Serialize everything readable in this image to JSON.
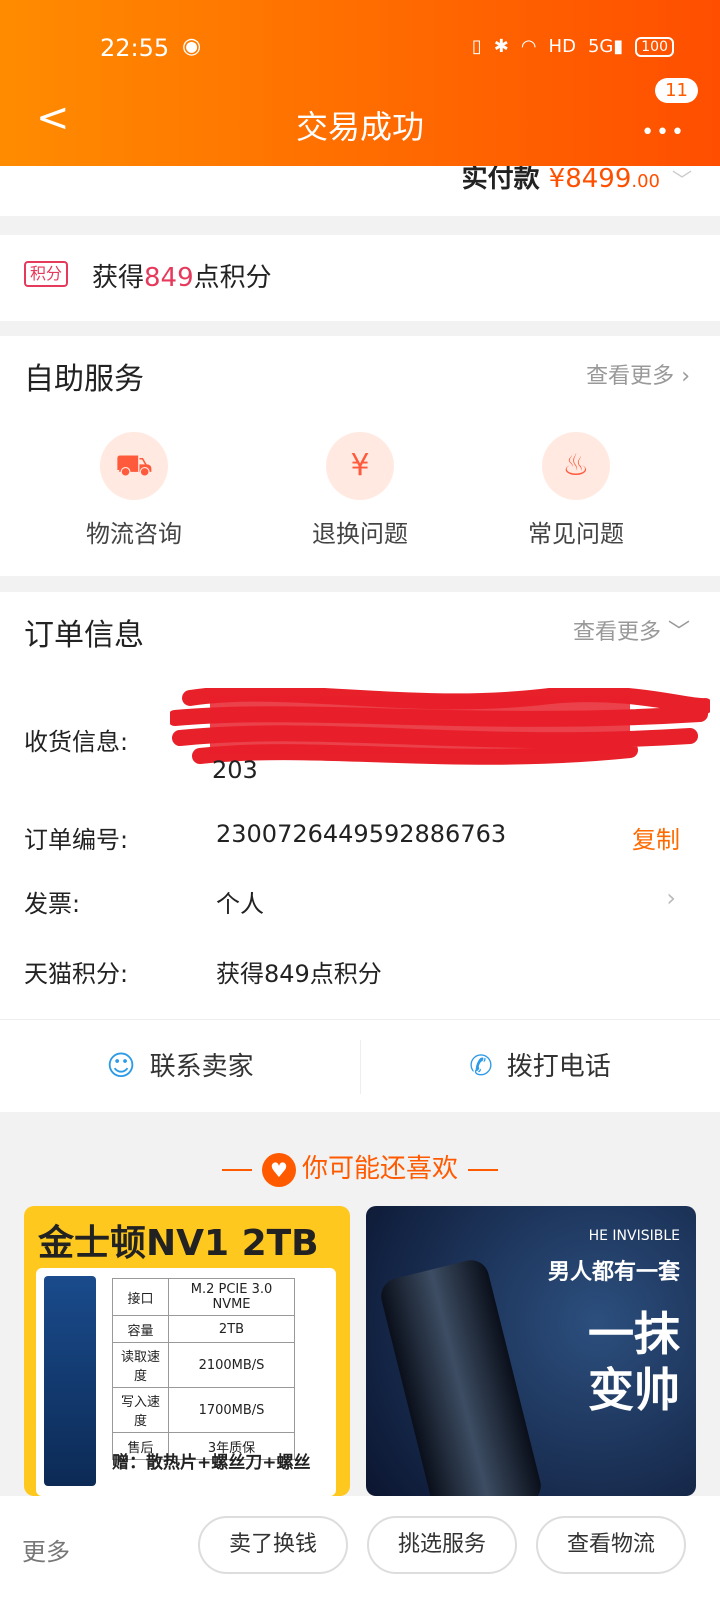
{
  "status_bar": {
    "time": "22:55",
    "battery": "100",
    "icons": [
      "vibrate-icon",
      "bluetooth-icon",
      "wifi-icon",
      "hd-icon",
      "signal-5g-icon"
    ]
  },
  "header": {
    "back_label": "<",
    "title": "交易成功",
    "more_badge": "11"
  },
  "payment": {
    "label": "实付款",
    "currency": "¥",
    "amount": "8499",
    "decimal": ".00"
  },
  "points": {
    "badge": "积分",
    "prefix": "获得",
    "value": "849",
    "suffix": "点积分"
  },
  "self_service": {
    "title": "自助服务",
    "more": "查看更多",
    "items": [
      {
        "label": "物流咨询",
        "icon": "truck-icon"
      },
      {
        "label": "退换问题",
        "icon": "refund-icon"
      },
      {
        "label": "常见问题",
        "icon": "fire-icon"
      }
    ]
  },
  "order_info": {
    "title": "订单信息",
    "more": "查看更多",
    "address_label": "收货信息:",
    "address_tail": "203",
    "order_no_label": "订单编号:",
    "order_no": "2300726449592886763",
    "copy_label": "复制",
    "invoice_label": "发票:",
    "invoice_value": "个人",
    "tmall_points_label": "天猫积分:",
    "tmall_points_value": "获得849点积分"
  },
  "contact": {
    "seller": "联系卖家",
    "phone": "拨打电话"
  },
  "recommend": {
    "title": "你可能还喜欢",
    "product1": {
      "headline": "金士顿NV1 2TB",
      "specs": [
        [
          "接口",
          "M.2 PCIE 3.0 NVME"
        ],
        [
          "容量",
          "2TB"
        ],
        [
          "读取速度",
          "2100MB/S"
        ],
        [
          "写入速度",
          "1700MB/S"
        ],
        [
          "售后",
          "3年质保"
        ]
      ],
      "gift": "赠：散热片+螺丝刀+螺丝"
    },
    "product2": {
      "tag": "HE INVISIBLE",
      "slogan": "男人都有一套",
      "big1": "一抹",
      "big2": "变帅"
    }
  },
  "bottom_bar": {
    "more": "更多",
    "btn1": "卖了换钱",
    "btn2": "挑选服务",
    "btn3": "查看物流"
  }
}
